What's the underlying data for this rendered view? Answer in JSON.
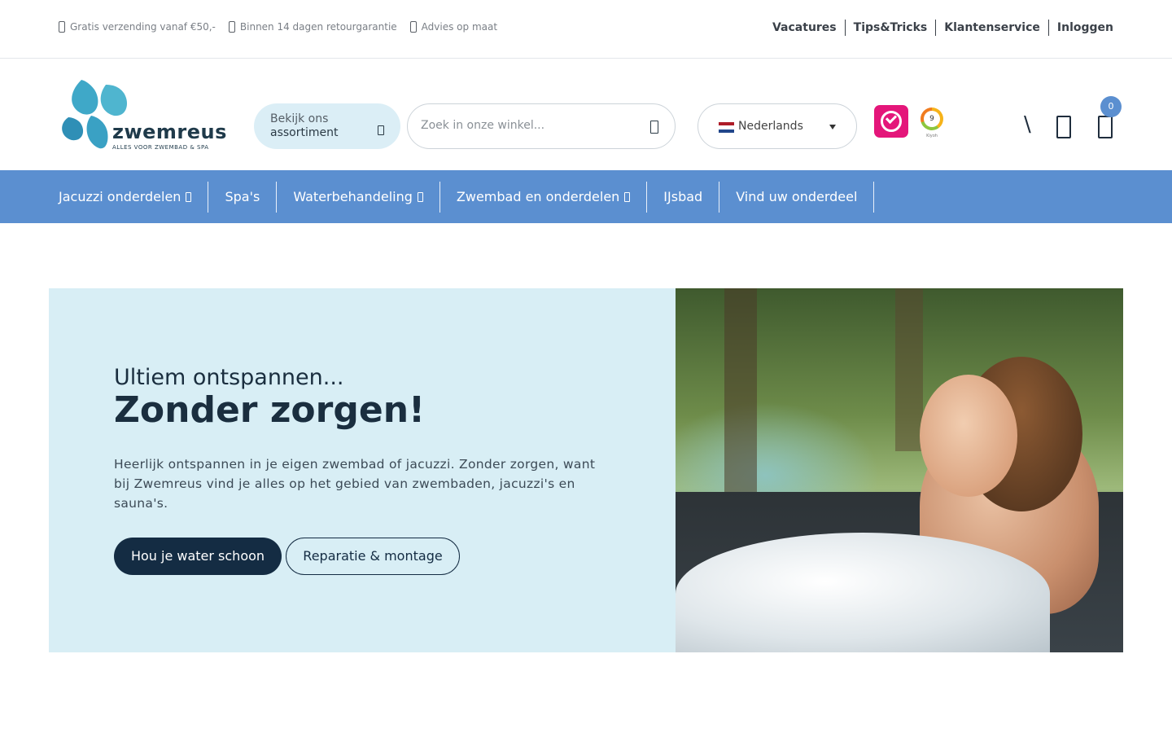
{
  "topbar": {
    "usps": [
      {
        "icon": "check-icon",
        "text": "Gratis verzending vanaf €50,-"
      },
      {
        "icon": "return-icon",
        "text": "Binnen 14 dagen retourgarantie"
      },
      {
        "icon": "advice-icon",
        "text": "Advies op maat"
      }
    ],
    "links": [
      "Vacatures",
      "Tips&Tricks",
      "Klantenservice",
      "Inloggen"
    ]
  },
  "header": {
    "logo": {
      "word": "zwemreus",
      "tagline": "ALLES VOOR ZWEMBAD & SPA"
    },
    "assortment_button": {
      "line1": "Bekijk ons",
      "line2": "assortiment",
      "icon": "chevron-down-icon"
    },
    "search": {
      "placeholder": "Zoek in onze winkel...",
      "icon": "search-icon"
    },
    "language": {
      "label": "Nederlands",
      "flag_colors": [
        "#ae1c28",
        "#ffffff",
        "#21468b"
      ]
    },
    "review_badge": {
      "score": "9",
      "source": "Kiyoh"
    },
    "cart_count": "0"
  },
  "nav": {
    "items": [
      {
        "label": "Jacuzzi onderdelen",
        "dropdown": true
      },
      {
        "label": "Spa's",
        "dropdown": false
      },
      {
        "label": "Waterbehandeling",
        "dropdown": true
      },
      {
        "label": "Zwembad en onderdelen",
        "dropdown": true
      },
      {
        "label": "IJsbad",
        "dropdown": false
      },
      {
        "label": "Vind uw onderdeel",
        "dropdown": false
      }
    ]
  },
  "hero": {
    "subtitle": "Ultiem ontspannen...",
    "title": "Zonder zorgen!",
    "text": "Heerlijk ontspannen in je eigen zwembad of jacuzzi. Zonder zorgen, want bij Zwemreus vind je alles op het gebied van zwembaden, jacuzzi's en sauna's.",
    "primary_button": "Hou je water schoon",
    "secondary_button": "Reparatie & montage"
  },
  "colors": {
    "nav_bg": "#5b8fd0",
    "hero_bg": "#d8eef5",
    "primary_button": "#142c43",
    "brand_pink": "#e4167a"
  }
}
